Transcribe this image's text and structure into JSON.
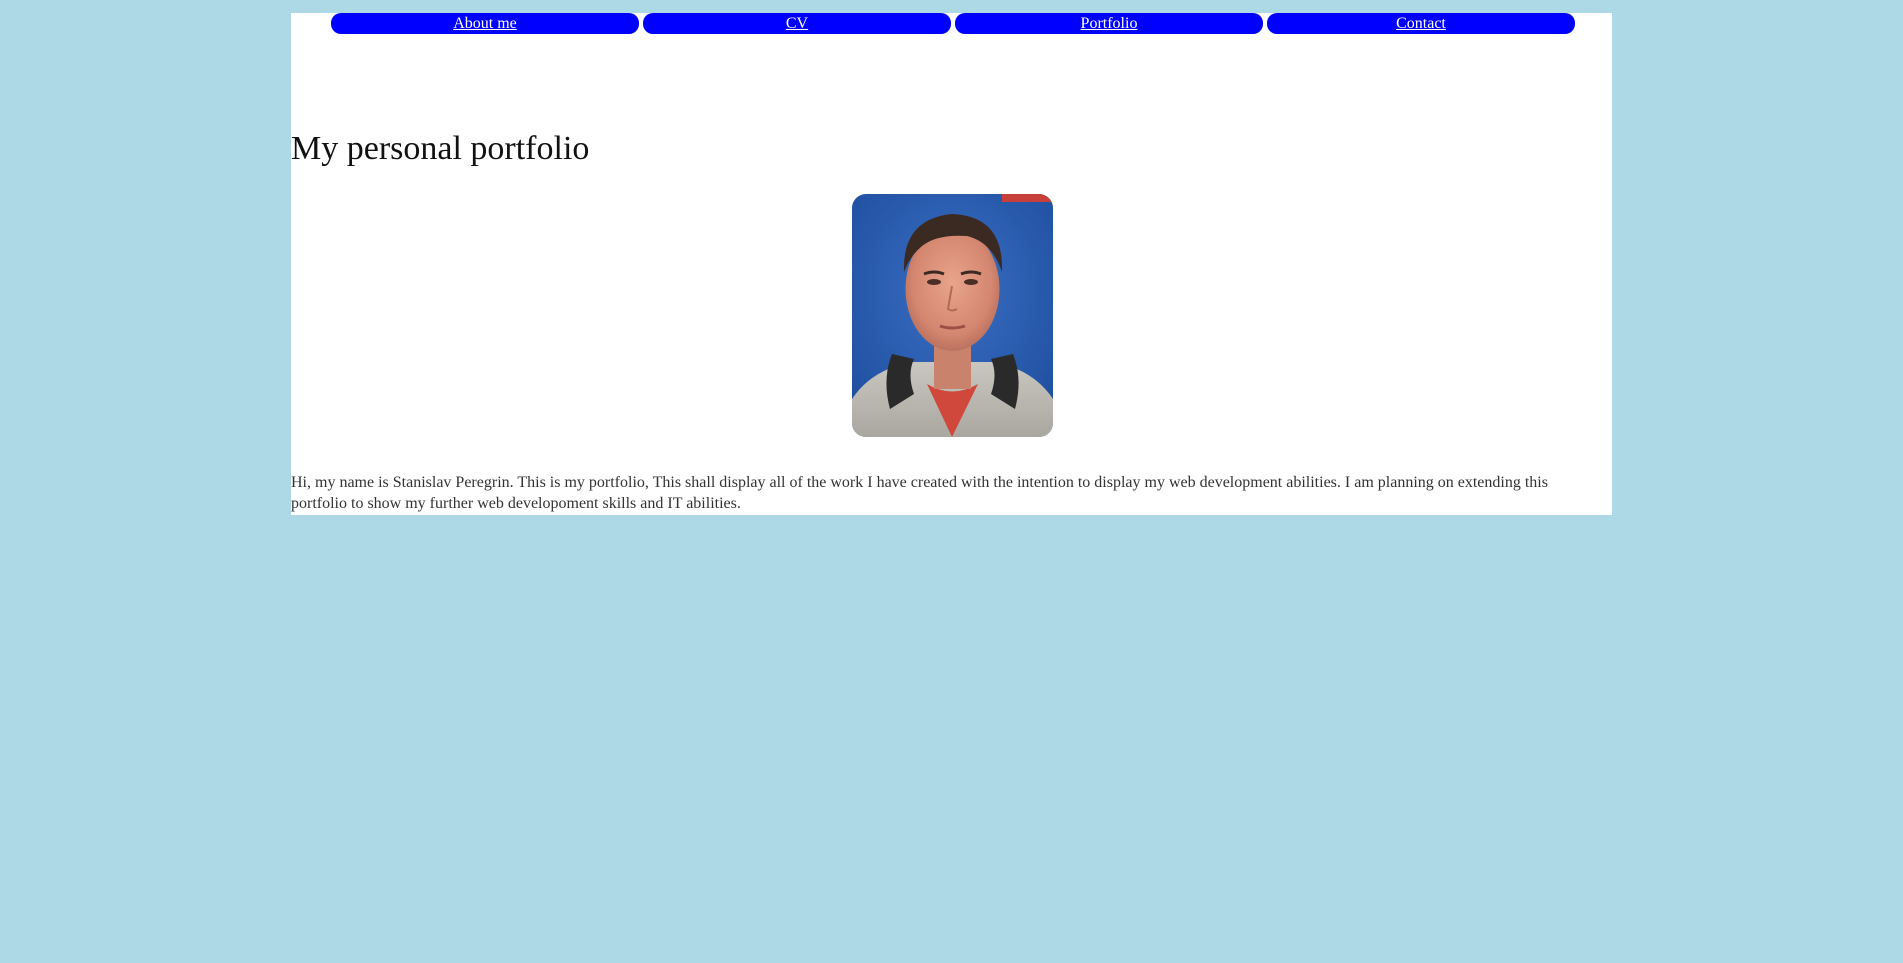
{
  "nav": {
    "items": [
      {
        "label": "About me"
      },
      {
        "label": "CV"
      },
      {
        "label": "Portfolio"
      },
      {
        "label": "Contact"
      }
    ]
  },
  "main": {
    "title": "My personal portfolio",
    "intro": "Hi, my name is Stanislav Peregrin. This is my portfolio, This shall display all of the work I have created with the intention to display my web development abilities. I am planning on extending this portfolio to show my further web developoment skills and IT abilities."
  },
  "colors": {
    "page_background": "#add8e6",
    "content_background": "#ffffff",
    "nav_button": "#0000ff",
    "nav_text": "#ffffff"
  }
}
